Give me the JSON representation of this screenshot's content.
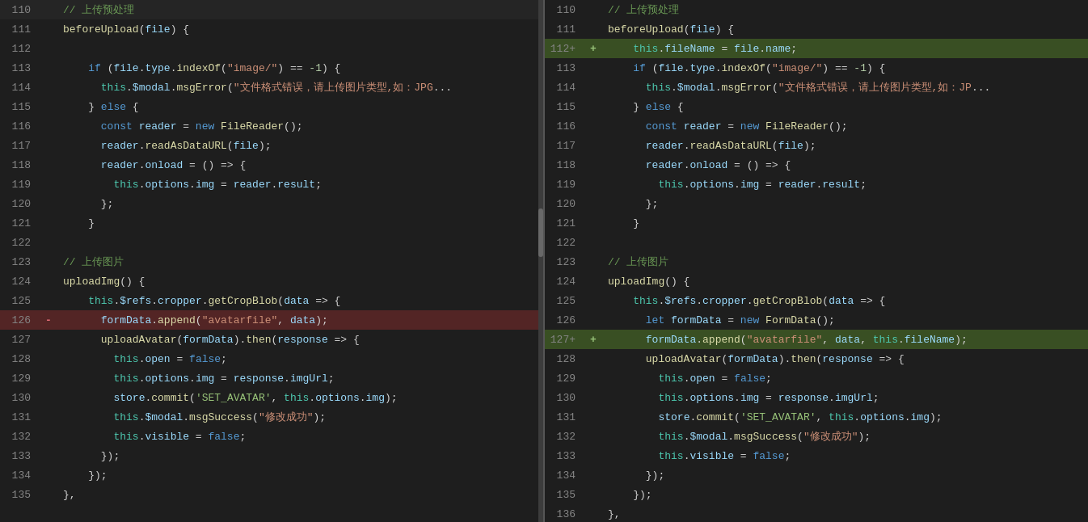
{
  "colors": {
    "bg": "#1e1e1e",
    "line_add_bg": "rgba(100,130,60,0.35)",
    "line_remove_bg": "rgba(180,50,50,0.35)",
    "line_add_strong_bg": "rgba(80,120,40,0.55)"
  },
  "left_pane": {
    "lines": [
      {
        "num": "110",
        "marker": " ",
        "content": "comment_upload_preprocess"
      },
      {
        "num": "111",
        "marker": " ",
        "content": "before_upload_file"
      },
      {
        "num": "112",
        "marker": " ",
        "content": "blank"
      },
      {
        "num": "113",
        "marker": " ",
        "content": "if_file_type"
      },
      {
        "num": "114",
        "marker": " ",
        "content": "modal_msg_error"
      },
      {
        "num": "115",
        "marker": " ",
        "content": "else"
      },
      {
        "num": "116",
        "marker": " ",
        "content": "const_reader"
      },
      {
        "num": "117",
        "marker": " ",
        "content": "reader_read"
      },
      {
        "num": "118",
        "marker": " ",
        "content": "reader_onload"
      },
      {
        "num": "119",
        "marker": " ",
        "content": "this_options_img"
      },
      {
        "num": "120",
        "marker": " ",
        "content": "close_brace_semi"
      },
      {
        "num": "121",
        "marker": " ",
        "content": "close_brace"
      },
      {
        "num": "122",
        "marker": " ",
        "content": "blank2"
      },
      {
        "num": "123",
        "marker": " ",
        "content": "comment_upload_img"
      },
      {
        "num": "124",
        "marker": " ",
        "content": "upload_img_func"
      },
      {
        "num": "125",
        "marker": " ",
        "content": "this_refs_cropper"
      },
      {
        "num": "126",
        "marker": "-",
        "content": "form_data_append_old",
        "type": "remove"
      },
      {
        "num": "127",
        "marker": " ",
        "content": "upload_avatar"
      },
      {
        "num": "128",
        "marker": " ",
        "content": "this_open_false"
      },
      {
        "num": "129",
        "marker": " ",
        "content": "this_options_img2"
      },
      {
        "num": "130",
        "marker": " ",
        "content": "store_commit"
      },
      {
        "num": "131",
        "marker": " ",
        "content": "this_modal_success"
      },
      {
        "num": "132",
        "marker": " ",
        "content": "this_visible_false"
      },
      {
        "num": "133",
        "marker": " ",
        "content": "close_brace_2"
      },
      {
        "num": "134",
        "marker": " ",
        "content": "close_bracket_semi"
      },
      {
        "num": "135",
        "marker": " ",
        "content": "close_brace_3"
      }
    ]
  },
  "right_pane": {
    "lines": [
      {
        "num": "110",
        "marker": " ",
        "content": "comment_upload_preprocess"
      },
      {
        "num": "111",
        "marker": " ",
        "content": "before_upload_file"
      },
      {
        "num": "112",
        "marker": "+",
        "content": "this_filename_add",
        "type": "add_strong"
      },
      {
        "num": "113",
        "marker": " ",
        "content": "if_file_type"
      },
      {
        "num": "114",
        "marker": " ",
        "content": "modal_msg_error"
      },
      {
        "num": "115",
        "marker": " ",
        "content": "else"
      },
      {
        "num": "116",
        "marker": " ",
        "content": "const_reader"
      },
      {
        "num": "117",
        "marker": " ",
        "content": "reader_read"
      },
      {
        "num": "118",
        "marker": " ",
        "content": "reader_onload"
      },
      {
        "num": "119",
        "marker": " ",
        "content": "this_options_img"
      },
      {
        "num": "120",
        "marker": " ",
        "content": "close_brace_semi"
      },
      {
        "num": "121",
        "marker": " ",
        "content": "close_brace"
      },
      {
        "num": "122",
        "marker": " ",
        "content": "blank2"
      },
      {
        "num": "123",
        "marker": " ",
        "content": "comment_upload_img"
      },
      {
        "num": "124",
        "marker": " ",
        "content": "upload_img_func"
      },
      {
        "num": "125",
        "marker": " ",
        "content": "this_refs_cropper"
      },
      {
        "num": "126",
        "marker": " ",
        "content": "let_form_data"
      },
      {
        "num": "127",
        "marker": "+",
        "content": "form_data_append_new",
        "type": "add_strong"
      },
      {
        "num": "128",
        "marker": " ",
        "content": "upload_avatar"
      },
      {
        "num": "129",
        "marker": " ",
        "content": "this_open_false"
      },
      {
        "num": "130",
        "marker": " ",
        "content": "this_options_img2"
      },
      {
        "num": "131",
        "marker": " ",
        "content": "store_commit"
      },
      {
        "num": "132",
        "marker": " ",
        "content": "this_modal_success"
      },
      {
        "num": "133",
        "marker": " ",
        "content": "this_visible_false"
      },
      {
        "num": "134",
        "marker": " ",
        "content": "close_brace_2"
      },
      {
        "num": "135",
        "marker": " ",
        "content": "close_bracket_semi"
      },
      {
        "num": "136",
        "marker": " ",
        "content": "close_brace_3"
      }
    ]
  }
}
